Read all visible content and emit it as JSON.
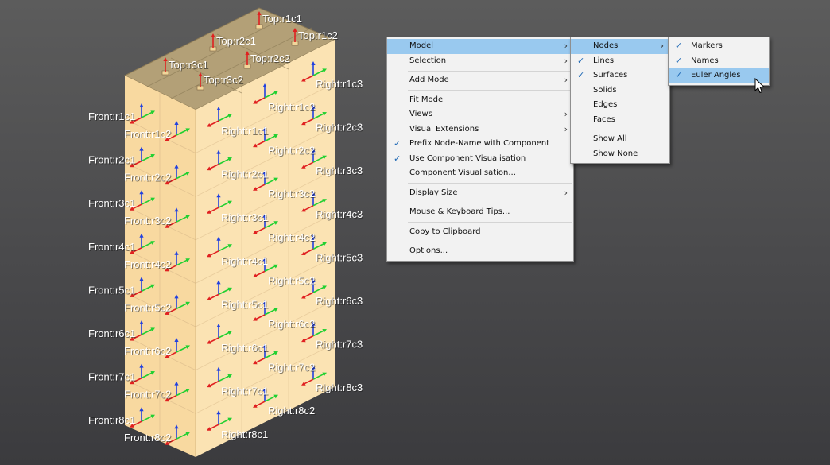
{
  "viewport": {
    "top_labels": [
      "Top:r1c1",
      "Top:r2c1",
      "Top:r1c2",
      "Top:r3c1",
      "Top:r2c2",
      "Top:r3c2"
    ],
    "front_labels": [
      "Front:r1c1",
      "Front:r1c2",
      "Front:r2c1",
      "Front:r2c2",
      "Front:r3c1",
      "Front:r3c2",
      "Front:r4c1",
      "Front:r4c2",
      "Front:r5c1",
      "Front:r5c2",
      "Front:r6c1",
      "Front:r6c2",
      "Front:r7c1",
      "Front:r7c2",
      "Front:r8c1",
      "Front:r8c2"
    ],
    "right_labels_inner": [
      "Right:r1c1",
      "Right:r2c1",
      "Right:r3c1",
      "Right:r4c1",
      "Right:r5c1",
      "Right:r6c1",
      "Right:r7c1",
      "Right:r8c1"
    ],
    "right_labels_mid": [
      "Right:r1c2",
      "Right:r2c2",
      "Right:r3c2",
      "Right:r4c2",
      "Right:r5c2",
      "Right:r6c2",
      "Right:r7c2",
      "Right:r8c2"
    ],
    "right_labels_outer": [
      "Right:r1c3",
      "Right:r2c3",
      "Right:r3c3",
      "Right:r4c3",
      "Right:r5c3",
      "Right:r6c3",
      "Right:r7c3",
      "Right:r8c3"
    ],
    "colors": {
      "top_face": "#b3a077",
      "front_face": "#fde1a9",
      "right_face": "#fbe5b6",
      "x_axis": "#e02020",
      "y_axis": "#20d030",
      "z_axis": "#2040e0"
    }
  },
  "main_menu": {
    "items": [
      {
        "label": "Model",
        "submenu": true,
        "highlighted": true
      },
      {
        "label": "Selection",
        "submenu": true
      },
      {
        "separator": true
      },
      {
        "label": "Add Mode",
        "submenu": true
      },
      {
        "separator": true
      },
      {
        "label": "Fit Model"
      },
      {
        "label": "Views",
        "submenu": true
      },
      {
        "label": "Visual Extensions",
        "submenu": true
      },
      {
        "label": "Prefix Node-Name with Component",
        "checked": true
      },
      {
        "label": "Use Component Visualisation",
        "checked": true
      },
      {
        "label": "Component Visualisation..."
      },
      {
        "separator": true
      },
      {
        "label": "Display Size",
        "submenu": true
      },
      {
        "separator": true
      },
      {
        "label": "Mouse & Keyboard Tips..."
      },
      {
        "separator": true
      },
      {
        "label": "Copy to Clipboard"
      },
      {
        "separator": true
      },
      {
        "label": "Options..."
      }
    ]
  },
  "model_menu": {
    "items": [
      {
        "label": "Nodes",
        "submenu": true,
        "highlighted": true
      },
      {
        "label": "Lines",
        "checked": true
      },
      {
        "label": "Surfaces",
        "checked": true
      },
      {
        "label": "Solids"
      },
      {
        "label": "Edges"
      },
      {
        "label": "Faces"
      },
      {
        "separator": true
      },
      {
        "label": "Show All"
      },
      {
        "label": "Show None"
      }
    ]
  },
  "nodes_menu": {
    "items": [
      {
        "label": "Markers",
        "checked": true
      },
      {
        "label": "Names",
        "checked": true
      },
      {
        "label": "Euler Angles",
        "checked": true,
        "highlighted": true
      }
    ]
  },
  "icons": {
    "check": "checkmark-icon",
    "submenu": "chevron-right-icon",
    "cursor": "mouse-pointer-icon"
  }
}
